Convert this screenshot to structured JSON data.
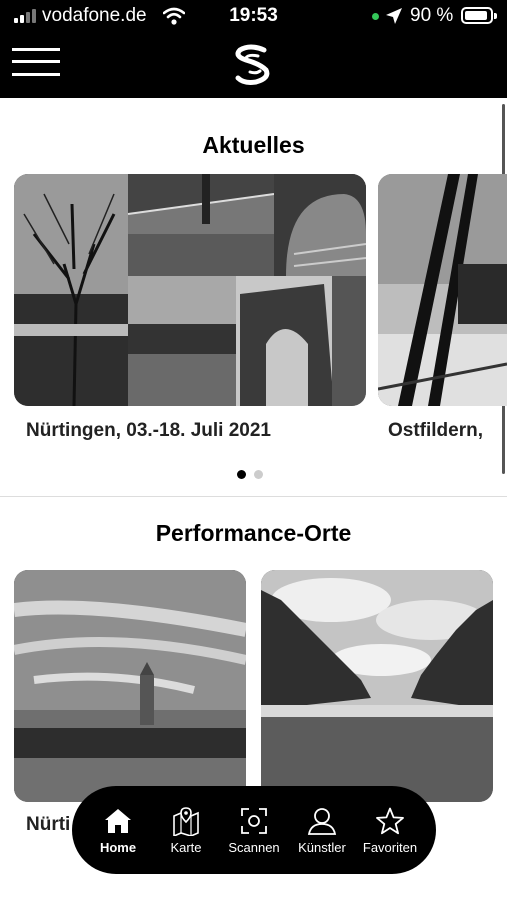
{
  "status_bar": {
    "carrier": "vodafone.de",
    "time": "19:53",
    "battery": "90 %",
    "battery_level": 0.9
  },
  "header": {
    "menu_icon": "hamburger-menu-icon",
    "logo_icon": "brand-logo-icon"
  },
  "sections": {
    "aktuelles": {
      "title": "Aktuelles",
      "cards": [
        {
          "caption": "Nürtingen, 03.-18. Juli 2021"
        },
        {
          "caption": "Ostfildern, "
        }
      ],
      "pager": {
        "count": 2,
        "active": 1
      }
    },
    "orte": {
      "title": "Performance-Orte",
      "cards": [
        {
          "caption": "Nürti"
        },
        {
          "caption": ""
        }
      ]
    }
  },
  "bottom_nav": [
    {
      "label": "Home",
      "icon": "home-icon",
      "active": true
    },
    {
      "label": "Karte",
      "icon": "map-icon",
      "active": false
    },
    {
      "label": "Scannen",
      "icon": "scan-icon",
      "active": false
    },
    {
      "label": "Künstler",
      "icon": "user-icon",
      "active": false
    },
    {
      "label": "Favoriten",
      "icon": "star-icon",
      "active": false
    }
  ],
  "colors": {
    "header_bg": "#000000",
    "nav_bg": "#000000",
    "location_dot": "#34c759"
  }
}
